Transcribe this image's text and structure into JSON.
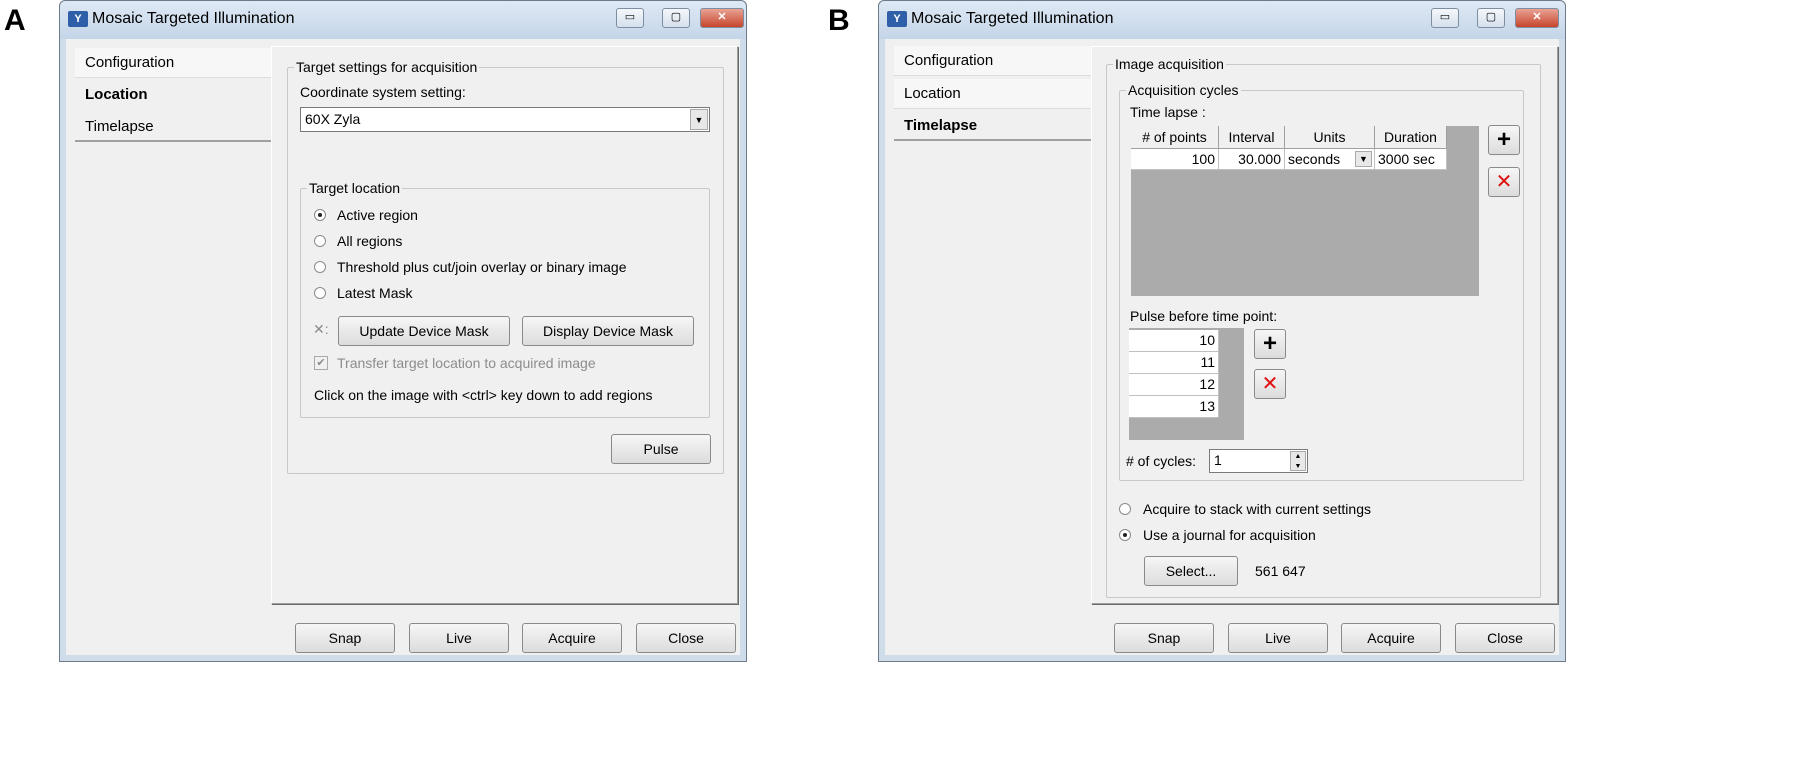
{
  "panels": [
    {
      "label": "A",
      "window": {
        "title": "Mosaic Targeted Illumination",
        "tabs": [
          "Configuration",
          "Location",
          "Timelapse"
        ],
        "selected_tab": "Location",
        "group_title": "Target settings for acquisition",
        "coord_label": "Coordinate system setting:",
        "coord_value": "60X Zyla",
        "location_group": "Target location",
        "radios": [
          {
            "label": "Active region",
            "checked": true
          },
          {
            "label": "All regions",
            "checked": false
          },
          {
            "label": "Threshold plus cut/join overlay or binary image",
            "checked": false
          },
          {
            "label": "Latest Mask",
            "checked": false
          }
        ],
        "update_mask": "Update Device  Mask",
        "display_mask": "Display Device Mask",
        "transfer_label": "Transfer target location to acquired image",
        "transfer_checked": true,
        "hint": "Click on the image with <ctrl> key down to add regions",
        "pulse": "Pulse",
        "buttons": [
          "Snap",
          "Live",
          "Acquire",
          "Close"
        ]
      }
    },
    {
      "label": "B",
      "window": {
        "title": "Mosaic Targeted Illumination",
        "tabs": [
          "Configuration",
          "Location",
          "Timelapse"
        ],
        "selected_tab": "Timelapse",
        "group_title": "Image acquisition",
        "cycles_group": "Acquisition cycles",
        "timelapse_label": "Time lapse :",
        "table": {
          "headers": [
            "# of points",
            "Interval",
            "Units",
            "Duration"
          ],
          "rows": [
            [
              "100",
              "30.000",
              "seconds",
              "3000 sec"
            ]
          ]
        },
        "pulse_label": "Pulse before time point:",
        "pulse_points": [
          "10",
          "11",
          "12",
          "13"
        ],
        "cycles_label": "# of cycles:",
        "cycles_value": "1",
        "radios": [
          {
            "label": "Acquire to stack with current settings",
            "checked": false
          },
          {
            "label": "Use a journal for acquisition",
            "checked": true
          }
        ],
        "select": "Select...",
        "journal_value": "561 647",
        "buttons": [
          "Snap",
          "Live",
          "Acquire",
          "Close"
        ]
      }
    }
  ],
  "icons": {
    "minimize": "minimize-icon",
    "maximize": "maximize-icon",
    "close": "close-icon",
    "add": "plus-icon",
    "remove": "x-icon"
  }
}
